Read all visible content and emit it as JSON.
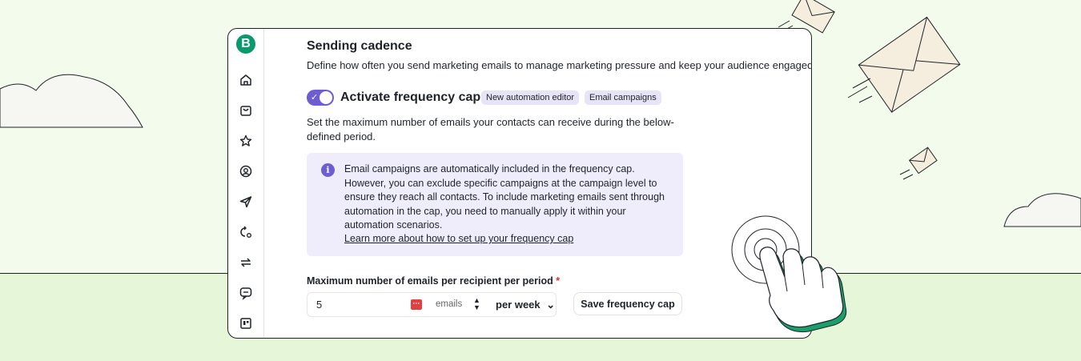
{
  "app": {
    "logo_letter": "B",
    "brand_color": "#0b996e",
    "accent_color": "#6d5dd3"
  },
  "sidebar": {
    "icons": [
      "home-icon",
      "shopping-bag-icon",
      "star-icon",
      "contact-icon",
      "send-icon",
      "automation-icon",
      "sync-icon",
      "chat-icon",
      "grid-icon"
    ]
  },
  "section": {
    "title": "Sending cadence",
    "description": "Define how often you send marketing emails to manage marketing pressure and keep your audience engaged."
  },
  "frequency_cap": {
    "toggle_on": true,
    "label": "Activate frequency cap",
    "badges": [
      "New automation editor",
      "Email campaigns"
    ],
    "help_text": "Set the maximum number of emails your contacts can receive during the below-defined period."
  },
  "info_box": {
    "icon": "i",
    "text": "Email campaigns are automatically included in the frequency cap. However, you can exclude specific campaigns at the campaign level to ensure they reach all contacts. To include marketing emails sent through automation in the cap, you need to manually apply it within your automation scenarios.",
    "link": "Learn more about how to set up your frequency cap"
  },
  "form": {
    "label": "Maximum number of emails per recipient per period",
    "required_mark": "*",
    "value": "5",
    "password_manager_icon": "···",
    "suffix": "emails",
    "spinner_up": "▲",
    "spinner_down": "▼",
    "period": "per week",
    "period_chevron": "⌄",
    "save_label": "Save frequency cap"
  }
}
